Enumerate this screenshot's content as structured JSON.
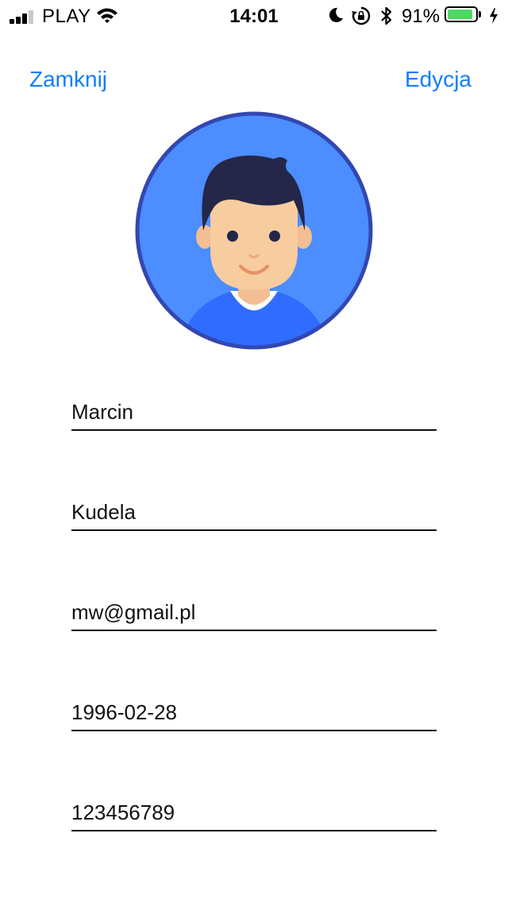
{
  "status_bar": {
    "carrier": "PLAY",
    "time": "14:01",
    "battery_percent": "91%",
    "battery_level": 0.91,
    "signal_bars": 3,
    "signal_bars_total": 4,
    "icons": [
      "signal-icon",
      "wifi-icon",
      "moon-icon",
      "rotation-lock-icon",
      "bluetooth-icon",
      "battery-icon",
      "charging-bolt-icon"
    ],
    "battery_color": "#4cd964"
  },
  "nav": {
    "close_label": "Zamknij",
    "edit_label": "Edycja",
    "accent_color": "#147efb"
  },
  "avatar": {
    "icon": "user-avatar-icon",
    "background_color": "#4c8dff",
    "border_color": "#3347b0"
  },
  "form": {
    "first_name": "Marcin",
    "last_name": "Kudela",
    "email": "mw@gmail.pl",
    "birth_date": "1996-02-28",
    "phone": "123456789"
  }
}
